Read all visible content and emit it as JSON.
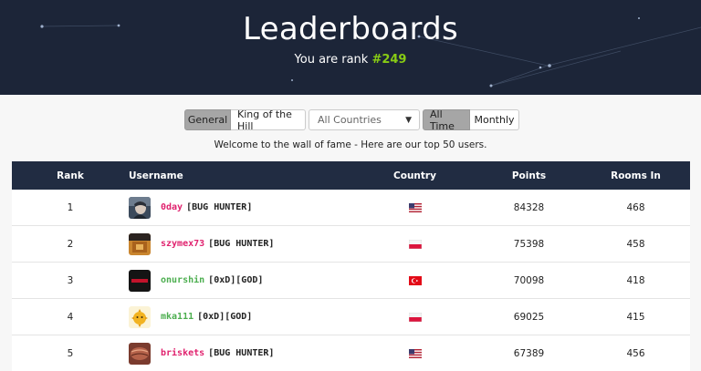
{
  "header": {
    "title": "Leaderboards",
    "rank_prefix": "You are rank ",
    "rank_value": "#249"
  },
  "filters": {
    "general": "General",
    "king_of_the_hill": "King of the Hill",
    "country_select": "All Countries",
    "all_time": "All Time",
    "monthly": "Monthly"
  },
  "welcome": "Welcome to the wall of fame - Here are our top 50 users.",
  "table": {
    "headers": {
      "rank": "Rank",
      "username": "Username",
      "country": "Country",
      "points": "Points",
      "rooms": "Rooms In"
    },
    "rows": [
      {
        "rank": "1",
        "username": "0day",
        "tag": "[BUG HUNTER]",
        "name_color": "#e0226e",
        "country_icon": "us-flag-icon",
        "points": "84328",
        "rooms": "468"
      },
      {
        "rank": "2",
        "username": "szymex73",
        "tag": "[BUG HUNTER]",
        "name_color": "#e0226e",
        "country_icon": "pl-flag-icon",
        "points": "75398",
        "rooms": "458"
      },
      {
        "rank": "3",
        "username": "onurshin",
        "tag": "[0xD][GOD]",
        "name_color": "#4cae4f",
        "country_icon": "tr-flag-icon",
        "points": "70098",
        "rooms": "418"
      },
      {
        "rank": "4",
        "username": "mka111",
        "tag": "[0xD][GOD]",
        "name_color": "#4cae4f",
        "country_icon": "pl-flag-icon",
        "points": "69025",
        "rooms": "415"
      },
      {
        "rank": "5",
        "username": "briskets",
        "tag": "[BUG HUNTER]",
        "name_color": "#e0226e",
        "country_icon": "us-flag-icon",
        "points": "67389",
        "rooms": "456"
      }
    ]
  },
  "colors": {
    "hero_bg": "#1c2538",
    "table_header_bg": "#212c42",
    "rank_accent": "#88cc14",
    "bug_hunter": "#e0226e",
    "god": "#4cae4f"
  }
}
